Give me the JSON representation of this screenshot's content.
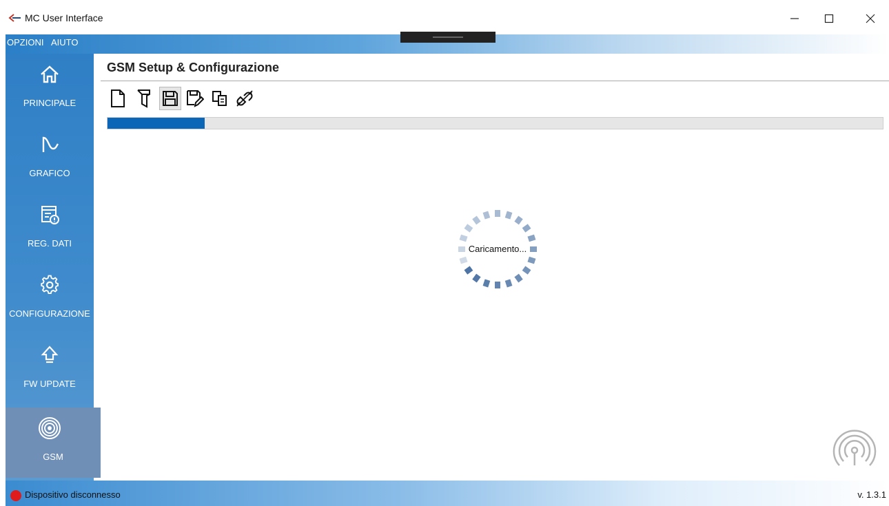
{
  "window": {
    "title": "MC User Interface"
  },
  "menu": {
    "items": [
      {
        "label": "OPZIONI"
      },
      {
        "label": "AIUTO"
      }
    ]
  },
  "sidebar": {
    "items": [
      {
        "label": "PRINCIPALE",
        "icon": "home-icon"
      },
      {
        "label": "GRAFICO",
        "icon": "chart-icon"
      },
      {
        "label": "REG. DATI",
        "icon": "data-log-icon"
      },
      {
        "label": "CONFIGURAZIONE",
        "icon": "gear-icon"
      },
      {
        "label": "FW UPDATE",
        "icon": "upload-icon"
      },
      {
        "label": "GSM",
        "icon": "antenna-icon",
        "active": true
      }
    ]
  },
  "main": {
    "title": "GSM Setup & Configurazione",
    "toolbar": [
      {
        "icon": "new-file-icon"
      },
      {
        "icon": "open-file-icon"
      },
      {
        "icon": "save-icon",
        "pressed": true
      },
      {
        "icon": "save-as-icon"
      },
      {
        "icon": "copy-icon"
      },
      {
        "icon": "disconnect-icon"
      }
    ],
    "progress": 0.125,
    "loading_text": "Caricamento..."
  },
  "status": {
    "text": "Dispositivo disconnesso",
    "version": "v. 1.3.1"
  },
  "colors": {
    "accent": "#0b66b8",
    "sidebar": "#3a86c9",
    "status_error": "#e01b1b"
  }
}
